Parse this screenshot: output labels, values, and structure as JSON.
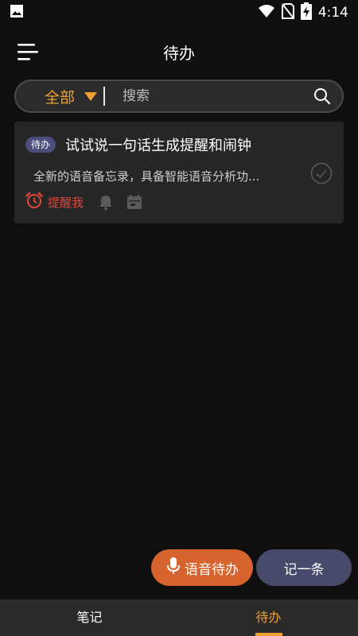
{
  "status_bar": {
    "time": "4:14",
    "icons": [
      "image-notification-icon",
      "wifi-icon",
      "no-sim-icon",
      "battery-charging-icon"
    ]
  },
  "header": {
    "title": "待办",
    "menu_icon": "menu-icon"
  },
  "search": {
    "filter_label": "全部",
    "placeholder": "搜索",
    "value": ""
  },
  "todo_items": [
    {
      "tag": "待办",
      "title": "试试说一句话生成提醒和闹钟",
      "description": "全新的语音备忘录，具备智能语音分析功...",
      "remind_label": "提醒我",
      "completed": false
    }
  ],
  "actions": {
    "voice_todo_label": "语音待办",
    "new_note_label": "记一条"
  },
  "bottom_nav": {
    "tabs": [
      "笔记",
      "待办"
    ],
    "active_index": 1
  },
  "colors": {
    "accent": "#f0a030",
    "voice_button": "#d7642e",
    "new_note_button": "#484a6c",
    "tag": "#4a4e7c",
    "reminder": "#e0453a",
    "background": "#0f0f0f"
  }
}
